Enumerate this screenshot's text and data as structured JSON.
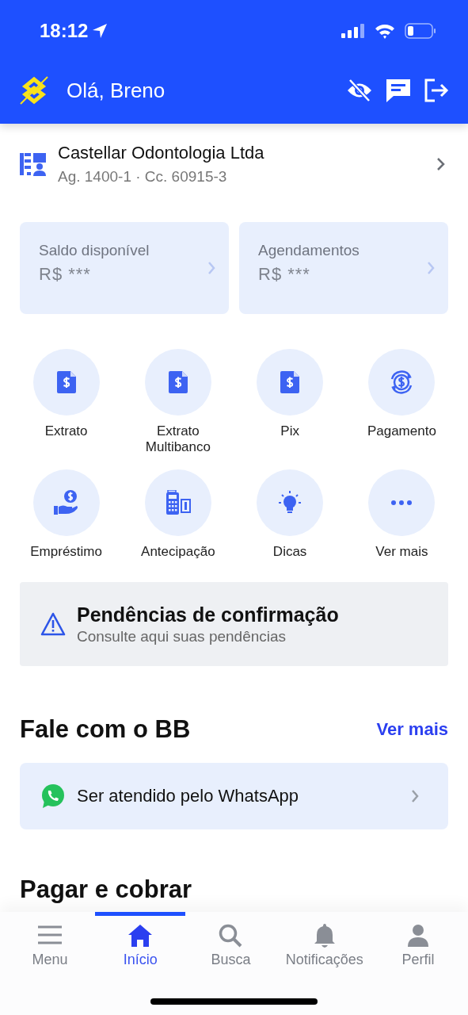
{
  "status_bar": {
    "time": "18:12"
  },
  "header": {
    "greeting": "Olá, Breno"
  },
  "account": {
    "name": "Castellar Odontologia Ltda",
    "details": "Ag. 1400-1 · Cc. 60915-3"
  },
  "balances": [
    {
      "label": "Saldo disponível",
      "value": "R$ ***"
    },
    {
      "label": "Agendamentos",
      "value": "R$ ***"
    }
  ],
  "shortcuts": [
    {
      "label": "Extrato",
      "kind": "document"
    },
    {
      "label": "Extrato Multibanco",
      "kind": "document"
    },
    {
      "label": "Pix",
      "kind": "document"
    },
    {
      "label": "Pagamento",
      "kind": "exchange"
    },
    {
      "label": "Empréstimo",
      "kind": "loan"
    },
    {
      "label": "Antecipação",
      "kind": "terminal"
    },
    {
      "label": "Dicas",
      "kind": "tip"
    },
    {
      "label": "Ver mais",
      "kind": "more"
    }
  ],
  "alert": {
    "title": "Pendências de confirmação",
    "subtitle": "Consulte aqui suas pendências"
  },
  "contact_section": {
    "title": "Fale com o BB",
    "link": "Ver mais",
    "item": "Ser atendido pelo WhatsApp"
  },
  "next_section": {
    "title": "Pagar e cobrar"
  },
  "nav": [
    {
      "label": "Menu",
      "kind": "menu",
      "selected": false
    },
    {
      "label": "Início",
      "kind": "home",
      "selected": true
    },
    {
      "label": "Busca",
      "kind": "search",
      "selected": false
    },
    {
      "label": "Notificações",
      "kind": "bell",
      "selected": false
    },
    {
      "label": "Perfil",
      "kind": "person",
      "selected": false
    }
  ]
}
